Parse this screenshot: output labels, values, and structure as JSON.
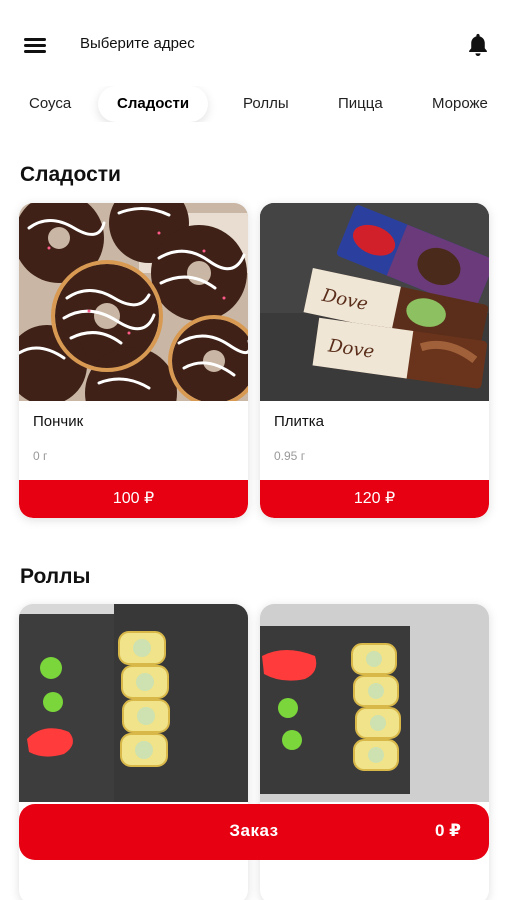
{
  "header": {
    "address_label": "Выберите адрес",
    "menu_icon": "hamburger-menu-icon",
    "bell_icon": "notification-bell-icon"
  },
  "categories": [
    {
      "label": "Соуса",
      "active": false
    },
    {
      "label": "Сладости",
      "active": true
    },
    {
      "label": "Роллы",
      "active": false
    },
    {
      "label": "Пицца",
      "active": false
    },
    {
      "label": "Мороже",
      "active": false
    }
  ],
  "sections": [
    {
      "title": "Сладости",
      "products": [
        {
          "name": "Пончик",
          "weight": "0 г",
          "price": "100 ₽",
          "image": "chocolate-donuts"
        },
        {
          "name": "Плитка",
          "weight": "0.95 г",
          "price": "120 ₽",
          "image": "chocolate-bars"
        }
      ]
    },
    {
      "title": "Роллы",
      "products": [
        {
          "name": "",
          "weight": "",
          "price": "",
          "image": "rolls-on-slate"
        },
        {
          "name": "",
          "weight": "",
          "price": "",
          "image": "rolls-on-slate"
        }
      ]
    }
  ],
  "order": {
    "label": "Заказ",
    "total": "0 ₽"
  },
  "colors": {
    "accent": "#e60012",
    "text": "#111111",
    "muted": "#999999"
  }
}
